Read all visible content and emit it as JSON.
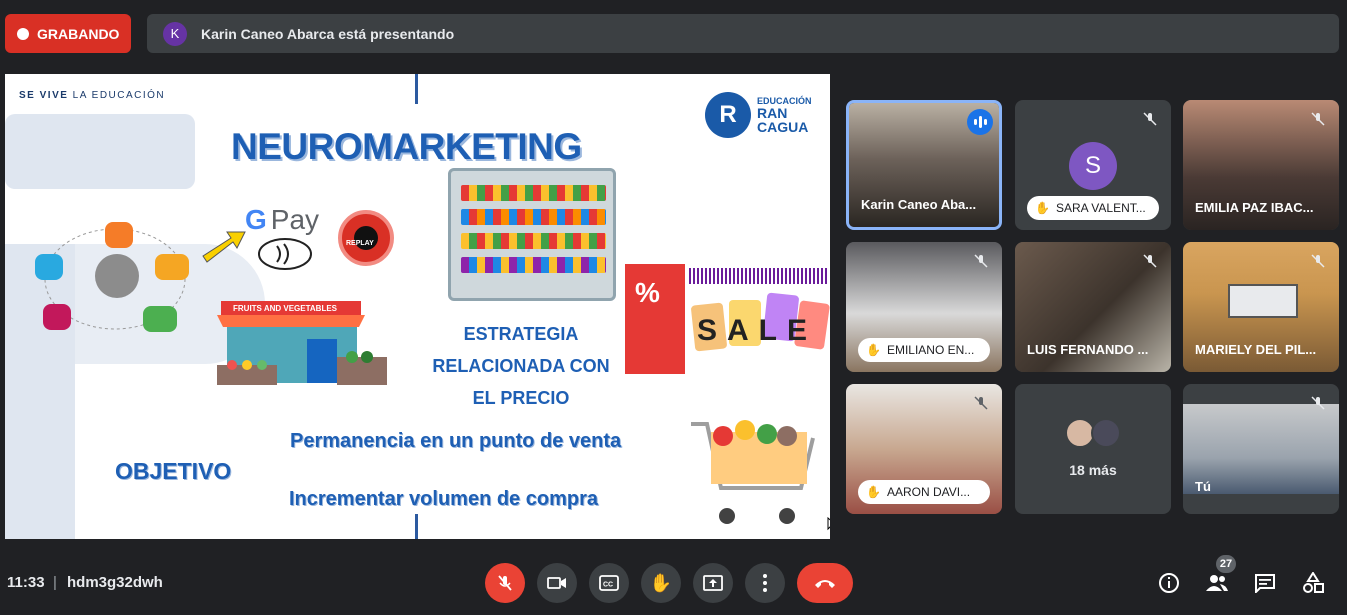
{
  "recording": {
    "label": "GRABANDO"
  },
  "presenter_bar": {
    "initial": "K",
    "text": "Karin Caneo Abarca está presentando"
  },
  "slide": {
    "tagline_bold": "SE VIVE",
    "tagline_rest": " LA EDUCACIÓN",
    "logo_letter": "R",
    "logo_small": "EDUCACIÓN",
    "logo_line1": "RAN",
    "logo_line2": "CAGUA",
    "title": "NEUROMARKETING",
    "gpay_g": "G",
    "gpay_pay": "Pay",
    "replay_label": "REPLAY",
    "store_sign": "FRUITS AND VEGETABLES",
    "sale_word": "SALE",
    "percent": "%",
    "estrategia": [
      "ESTRATEGIA",
      "RELACIONADA CON",
      "EL PRECIO"
    ],
    "objetivo": "OBJETIVO",
    "permanencia": "Permanencia en un punto de venta",
    "incrementar": "Incrementar volumen de compra"
  },
  "participants": [
    {
      "name": "Karin Caneo Aba...",
      "speaking": true,
      "raised_hand": false
    },
    {
      "name": "SARA VALENT...",
      "initial": "S",
      "raised_hand": true,
      "muted": true
    },
    {
      "name": "EMILIA PAZ IBAC...",
      "raised_hand": false,
      "muted": true
    },
    {
      "name": "EMILIANO EN...",
      "raised_hand": true,
      "muted": true
    },
    {
      "name": "LUIS FERNANDO ...",
      "raised_hand": false,
      "muted": true
    },
    {
      "name": "MARIELY DEL PIL...",
      "raised_hand": false,
      "muted": true
    },
    {
      "name": "AARON DAVI...",
      "raised_hand": true,
      "muted": true
    },
    {
      "name": "18 más"
    },
    {
      "name": "Tú",
      "muted": true
    }
  ],
  "bottom_bar": {
    "time": "11:33",
    "separator": "|",
    "meeting_code": "hdm3g32dwh",
    "people_count": "27"
  },
  "colors": {
    "record_red": "#d93025",
    "speaking_blue": "#1a73e8",
    "active_border": "#8ab4f8",
    "slide_blue": "#1e5fb4"
  },
  "icons": [
    "mic-off-icon",
    "camera-icon",
    "captions-icon",
    "raise-hand-icon",
    "present-icon",
    "more-icon",
    "hangup-icon",
    "info-icon",
    "people-icon",
    "chat-icon",
    "activities-icon"
  ]
}
